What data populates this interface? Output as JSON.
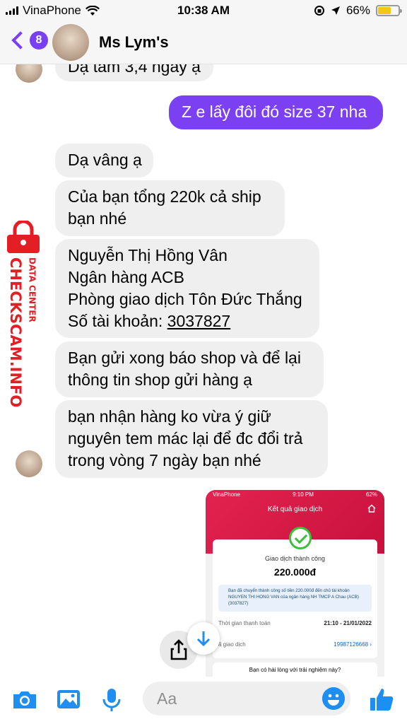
{
  "status_bar": {
    "carrier": "VinaPhone",
    "time": "10:38 AM",
    "battery": "66%",
    "battery_level": 0.66
  },
  "header": {
    "back_count": "8",
    "contact_name": "Ms Lym's"
  },
  "messages": [
    {
      "from": "them",
      "text": "Dạ tam 3,4 ngày ạ"
    },
    {
      "from": "me",
      "text": "Z e lấy đôi đó size 37 nha"
    },
    {
      "from": "them",
      "text": "Dạ vâng ạ"
    },
    {
      "from": "them",
      "lines": [
        "Của bạn tổng 220k cả ship",
        "bạn nhé"
      ]
    },
    {
      "from": "them",
      "lines": [
        "Nguyễn Thị Hồng Vân",
        "Ngân hàng ACB",
        "Phòng giao dịch Tôn Đức Thắng"
      ],
      "account_label": "Số tài khoản: ",
      "account_number": "3037827"
    },
    {
      "from": "them",
      "lines": [
        "Bạn gửi xong báo shop và để lại",
        "thông tin shop gửi hàng ạ"
      ]
    },
    {
      "from": "them",
      "lines": [
        "bạn nhận hàng ko vừa ý giữ",
        "nguyên tem mác lại để đc đổi trả",
        "trong vòng 7 ngày bạn nhé"
      ]
    }
  ],
  "receipt": {
    "carrier": "VinaPhone",
    "time": "9:10 PM",
    "battery": "62%",
    "title": "Kết quả giao dịch",
    "status": "Giao dịch thành công",
    "amount": "220.000đ",
    "info": "Bạn đã chuyển thành công số tiền 220.000đ đến chủ tài khoản NGUYEN THI HONG VAN của ngân hàng NH TMCP A Chau (ACB)(3037827)",
    "time_label": "Thời gian thanh toán",
    "time_value": "21:10 - 21/01/2022",
    "code_label": "ã giao dịch",
    "code_value": "19987126668 ›",
    "question": "Bạn có hài lòng với trải nghiệm này?"
  },
  "watermark": {
    "brand": "CHECKSCAM.INFO",
    "subtitle": "DATA CENTER"
  },
  "composer": {
    "placeholder": "Aa"
  },
  "colors": {
    "accent": "#7b40f2",
    "bubble": "#efefef",
    "messenger_blue": "#1e8ef0",
    "watermark_red": "#e31e24"
  }
}
